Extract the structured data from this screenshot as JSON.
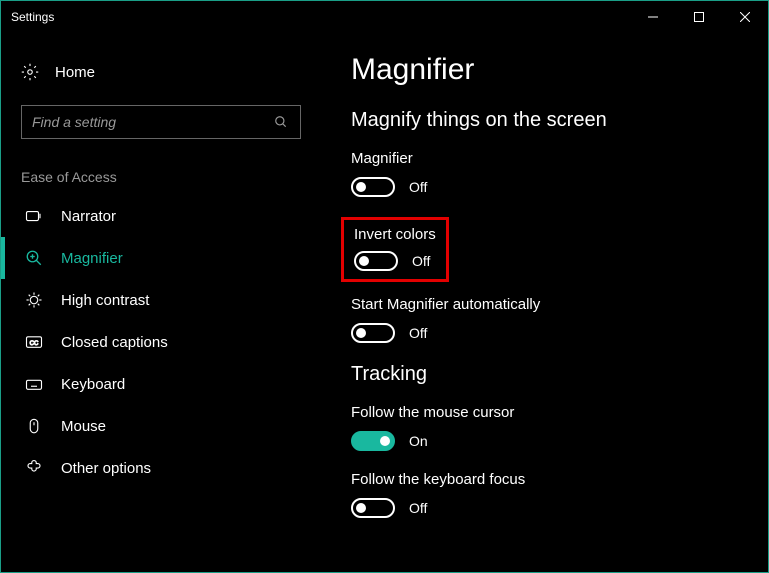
{
  "window": {
    "title": "Settings"
  },
  "home": {
    "label": "Home"
  },
  "search": {
    "placeholder": "Find a setting"
  },
  "sidebar": {
    "category": "Ease of Access",
    "items": [
      {
        "label": "Narrator"
      },
      {
        "label": "Magnifier"
      },
      {
        "label": "High contrast"
      },
      {
        "label": "Closed captions"
      },
      {
        "label": "Keyboard"
      },
      {
        "label": "Mouse"
      },
      {
        "label": "Other options"
      }
    ]
  },
  "main": {
    "title": "Magnifier",
    "sections": [
      {
        "title": "Magnify things on the screen",
        "settings": [
          {
            "label": "Magnifier",
            "on": false,
            "state": "Off",
            "highlight": false
          },
          {
            "label": "Invert colors",
            "on": false,
            "state": "Off",
            "highlight": true
          },
          {
            "label": "Start Magnifier automatically",
            "on": false,
            "state": "Off",
            "highlight": false
          }
        ]
      },
      {
        "title": "Tracking",
        "settings": [
          {
            "label": "Follow the mouse cursor",
            "on": true,
            "state": "On",
            "highlight": false
          },
          {
            "label": "Follow the keyboard focus",
            "on": false,
            "state": "Off",
            "highlight": false
          }
        ]
      }
    ]
  },
  "colors": {
    "accent": "#19b89f",
    "highlight": "#e30000"
  }
}
